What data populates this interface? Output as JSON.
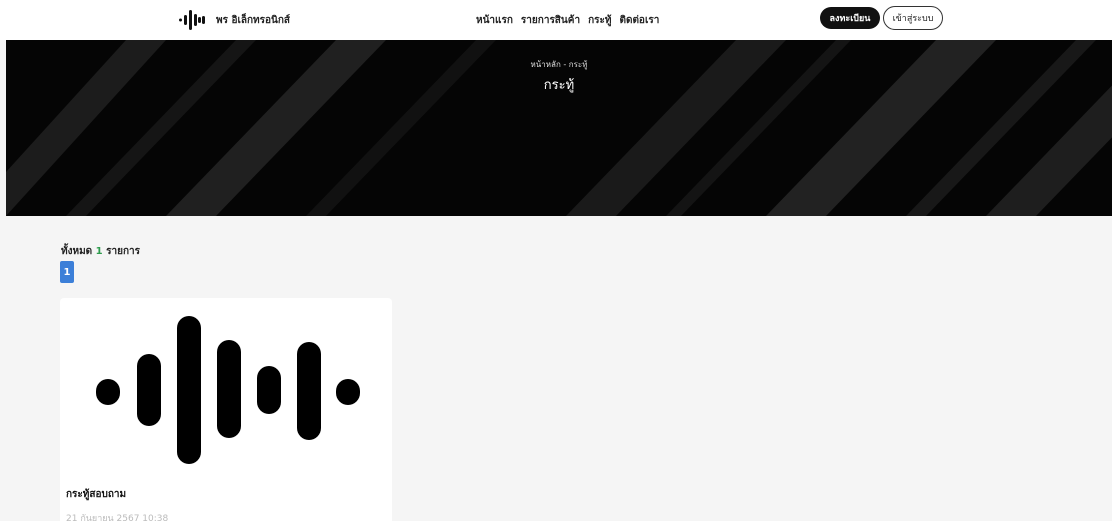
{
  "brand": {
    "name": "พร อิเล็กทรอนิกส์",
    "logo_icon": "sound-wave-icon"
  },
  "nav": {
    "items": [
      "หน้าแรก",
      "รายการสินค้า",
      "กระทู้",
      "ติดต่อเรา"
    ]
  },
  "auth": {
    "register_label": "ลงทะเบียน",
    "login_label": "เข้าสู่ระบบ"
  },
  "banner": {
    "breadcrumb": "หน้าหลัก - กระทู้",
    "title": "กระทู้"
  },
  "listing": {
    "total_prefix": "ทั้งหมด",
    "total_count": "1",
    "total_suffix": "รายการ",
    "current_page": "1"
  },
  "posts": [
    {
      "title": "กระทู้สอบถาม",
      "date": "21 กันยายน 2567 10:38",
      "image_icon": "sound-wave-icon"
    }
  ],
  "colors": {
    "header_bg": "#ffffff",
    "banner_bg": "#000000",
    "page_bg": "#f5f5f5",
    "pagination_active": "#3c7fd8",
    "count_accent": "#2e9b4d"
  }
}
